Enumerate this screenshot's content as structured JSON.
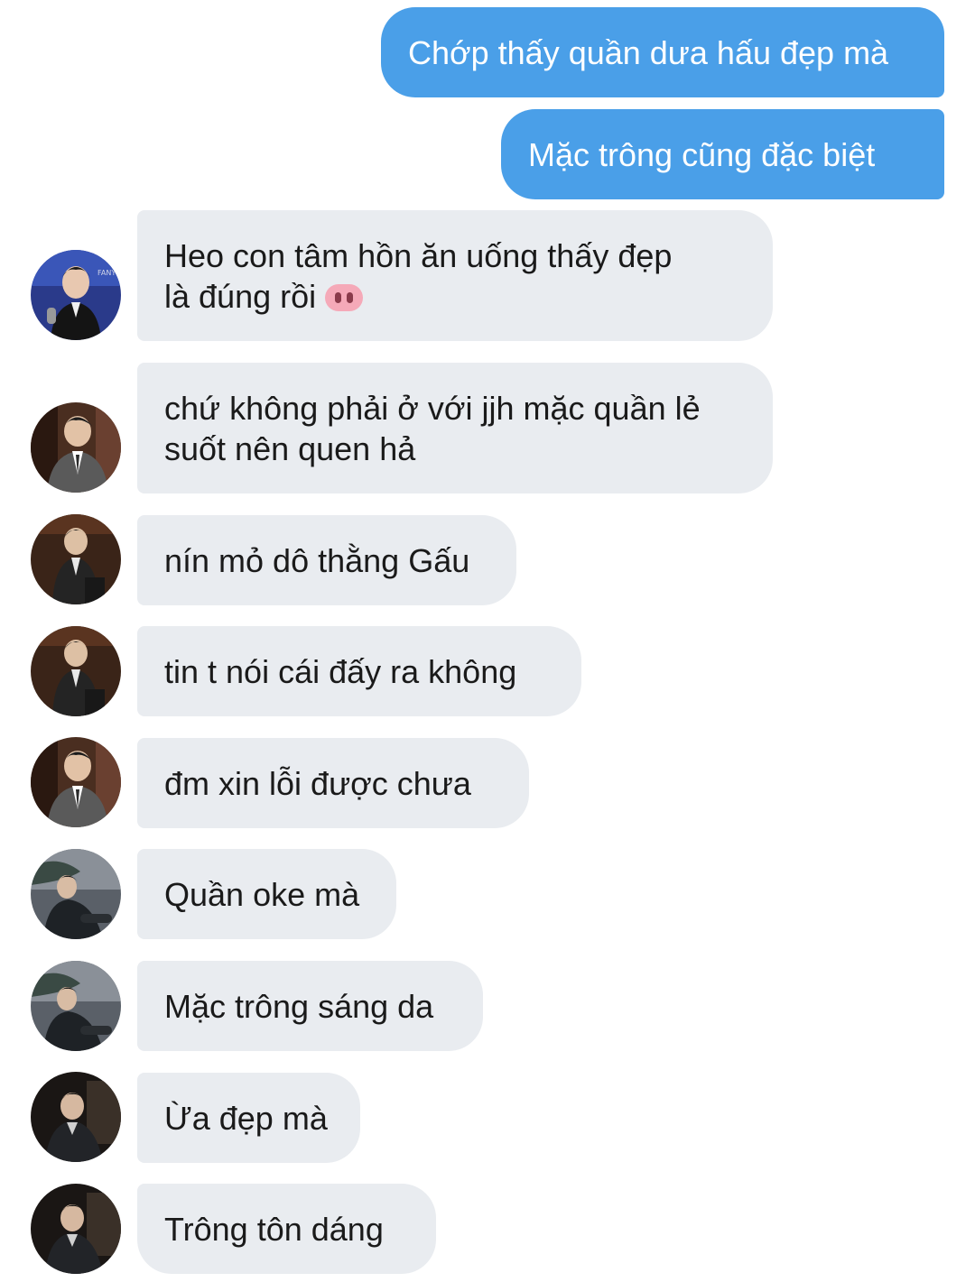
{
  "sent_messages": [
    {
      "text": "Chớp thấy quần dưa hấu đẹp mà"
    },
    {
      "text": "Mặc trông cũng đặc biệt"
    }
  ],
  "received_messages": [
    {
      "text": "Heo con tâm hồn ăn uống thấy đẹp\nlà đúng rồi",
      "emoji": "pig-nose-icon"
    },
    {
      "text": "chứ không phải ở với jjh mặc quần lẻ\nsuốt nên quen hả"
    },
    {
      "text": "nín mỏ dô thằng Gấu"
    },
    {
      "text": "tin t nói cái đấy ra không"
    },
    {
      "text": "đm xin lỗi được chưa"
    },
    {
      "text": "Quần oke mà"
    },
    {
      "text": "Mặc trông sáng da"
    },
    {
      "text": "Ừa đẹp mà"
    },
    {
      "text": "Trông tôn dáng"
    }
  ],
  "avatar_logo_text": "FANY&CO",
  "colors": {
    "sent_bubble": "#4a9fe8",
    "received_bubble": "#e9ecf0",
    "background": "#ffffff"
  }
}
